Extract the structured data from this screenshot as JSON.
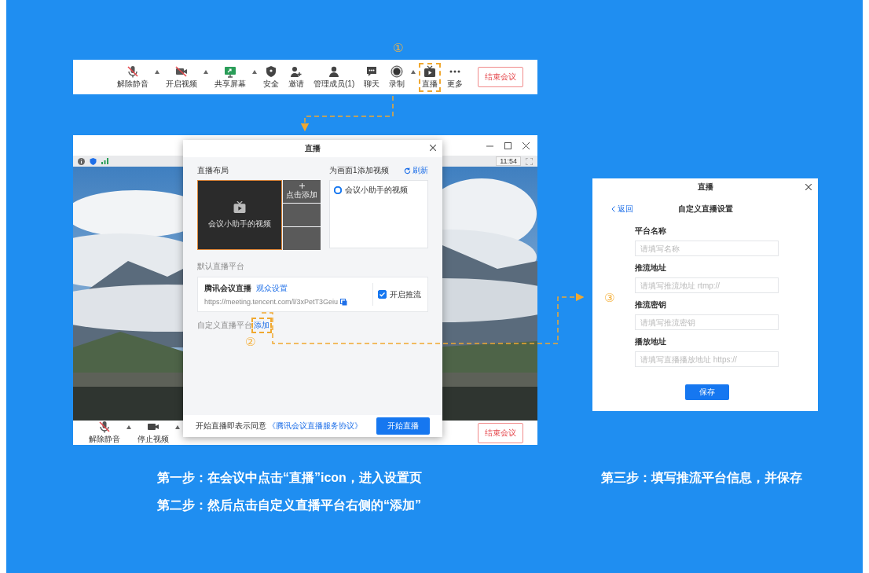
{
  "toolbar": {
    "items": [
      {
        "label": "解除静音",
        "kind": "mic-off",
        "caret": true,
        "highlighted": false
      },
      {
        "label": "开启视频",
        "kind": "camera-off",
        "caret": true,
        "highlighted": false
      },
      {
        "label": "共享屏幕",
        "kind": "screen",
        "caret": true,
        "highlighted": false
      },
      {
        "label": "安全",
        "kind": "shield",
        "caret": false,
        "highlighted": false
      },
      {
        "label": "邀请",
        "kind": "invite",
        "caret": false,
        "highlighted": false
      },
      {
        "label": "管理成员(1)",
        "kind": "members",
        "caret": false,
        "highlighted": false
      },
      {
        "label": "聊天",
        "kind": "chat",
        "caret": false,
        "highlighted": false
      },
      {
        "label": "录制",
        "kind": "record",
        "caret": true,
        "highlighted": false
      },
      {
        "label": "直播",
        "kind": "live",
        "caret": false,
        "highlighted": true
      },
      {
        "label": "更多",
        "kind": "more",
        "caret": false,
        "highlighted": false
      }
    ],
    "end_button": "结束会议",
    "marker": "①"
  },
  "meeting_window": {
    "time": "11:54",
    "bottom_toolbar": {
      "items": [
        {
          "label": "解除静音",
          "kind": "mic-off",
          "caret": true,
          "highlighted": false
        },
        {
          "label": "停止视频",
          "kind": "camera",
          "caret": true,
          "highlighted": false
        }
      ],
      "end_button": "结束会议"
    },
    "live_dialog": {
      "title": "直播",
      "layout_label": "直播布局",
      "main_tile": "会议小助手的视频",
      "add_tile": "点击添加",
      "video_panel": {
        "title": "为画面1添加视频",
        "refresh": "刷新",
        "sources": [
          {
            "label": "会议小助手的视频",
            "selected": true
          }
        ]
      },
      "default_platform_label": "默认直播平台",
      "platform": {
        "name": "腾讯会议直播",
        "settings_link": "观众设置",
        "url": "https://meeting.tencent.com/l/3xPetT3Geiu",
        "push_label": "开启推流",
        "push_enabled": true
      },
      "custom_platform_label": "自定义直播平台",
      "add_link": "添加",
      "add_highlighted": true,
      "marker": "②",
      "footer": {
        "agreement_text": "开始直播即表示同意",
        "agreement_link": "《腾讯会议直播服务协议》",
        "start_button": "开始直播"
      }
    }
  },
  "custom_dialog": {
    "title": "直播",
    "back": "返回",
    "heading": "自定义直播设置",
    "fields": [
      {
        "label": "平台名称",
        "placeholder": "请填写名称"
      },
      {
        "label": "推流地址",
        "placeholder": "请填写推流地址 rtmp://"
      },
      {
        "label": "推流密钥",
        "placeholder": "请填写推流密钥"
      },
      {
        "label": "播放地址",
        "placeholder": "请填写直播播放地址 https://"
      }
    ],
    "save_button": "保存",
    "marker": "③"
  },
  "captions": [
    {
      "text": "第一步：在会议中点击“直播”icon，进入设置页"
    },
    {
      "text": "第二步：然后点击自定义直播平台右侧的“添加”"
    },
    {
      "text": "第三步：填写推流平台信息，并保存"
    }
  ]
}
